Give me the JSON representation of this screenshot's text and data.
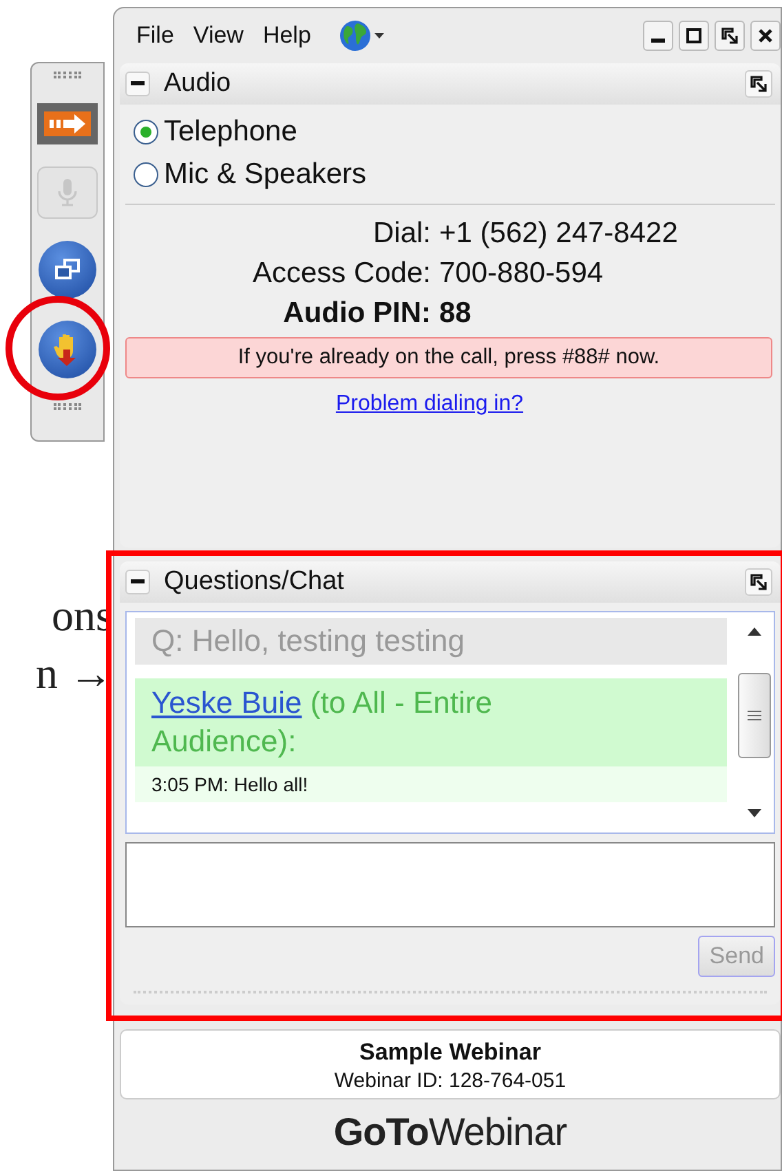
{
  "annotation": {
    "lines": [
      "ons",
      "n →"
    ]
  },
  "toolbar": {
    "buttons": [
      {
        "kind": "arrow",
        "disabled": false
      },
      {
        "kind": "mic",
        "disabled": true
      },
      {
        "kind": "windows",
        "disabled": false
      },
      {
        "kind": "hand",
        "disabled": false
      }
    ]
  },
  "menu": [
    "File",
    "View",
    "Help"
  ],
  "audio": {
    "title": "Audio",
    "options": [
      {
        "label": "Telephone",
        "selected": true
      },
      {
        "label": "Mic & Speakers",
        "selected": false
      }
    ],
    "details": [
      {
        "label": "Dial:",
        "value": "+1 (562) 247-8422",
        "bold": false
      },
      {
        "label": "Access Code:",
        "value": "700-880-594",
        "bold": false
      },
      {
        "label": "Audio PIN:",
        "value": "88",
        "bold": true
      }
    ],
    "notice": "If you're already on the call, press #88# now.",
    "link": "Problem dialing in?"
  },
  "chat": {
    "title": "Questions/Chat",
    "messages": [
      {
        "kind": "question",
        "text": "Q: Hello, testing testing"
      },
      {
        "kind": "reply",
        "sender": "Yeske Buie",
        "audience": "(to All - Entire Audience):",
        "body": "3:05 PM: Hello all!"
      }
    ],
    "send": "Send",
    "send_disabled": true
  },
  "footer": {
    "title": "Sample Webinar",
    "id": "Webinar ID: 128-764-051"
  },
  "brand": {
    "bold": "GoTo",
    "rest": "Webinar"
  }
}
